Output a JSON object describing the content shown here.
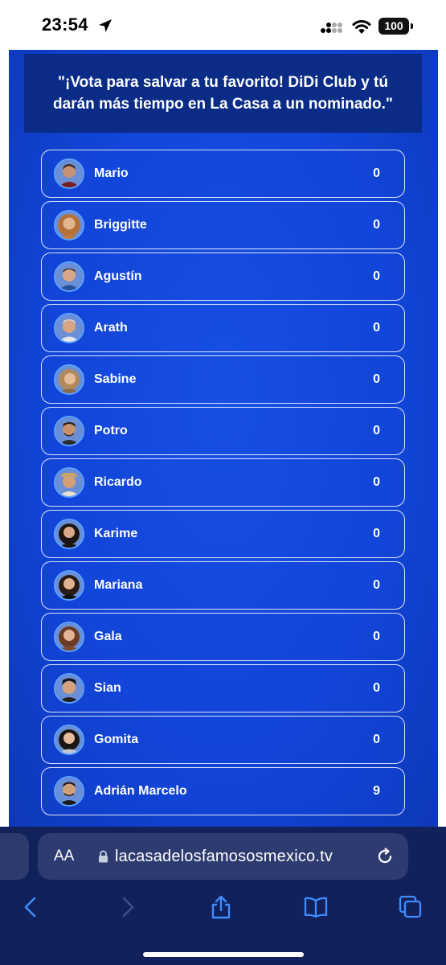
{
  "status_bar": {
    "time": "23:54",
    "battery": "100"
  },
  "banner": {
    "text": "\"¡Vota para salvar a tu favorito! DiDi Club y tú darán más tiempo en La Casa a un nominado.\""
  },
  "contestants": [
    {
      "name": "Mario",
      "votes": "0"
    },
    {
      "name": "Briggitte",
      "votes": "0"
    },
    {
      "name": "Agustín",
      "votes": "0"
    },
    {
      "name": "Arath",
      "votes": "0"
    },
    {
      "name": "Sabine",
      "votes": "0"
    },
    {
      "name": "Potro",
      "votes": "0"
    },
    {
      "name": "Ricardo",
      "votes": "0"
    },
    {
      "name": "Karime",
      "votes": "0"
    },
    {
      "name": "Mariana",
      "votes": "0"
    },
    {
      "name": "Gala",
      "votes": "0"
    },
    {
      "name": "Sian",
      "votes": "0"
    },
    {
      "name": "Gomita",
      "votes": "0"
    },
    {
      "name": "Adrián Marcelo",
      "votes": "9"
    }
  ],
  "browser": {
    "text_size_label": "AA",
    "url": "lacasadelosfamososmexico.tv",
    "icons": [
      "back-icon",
      "forward-icon",
      "share-icon",
      "bookmarks-icon",
      "tabs-icon"
    ]
  },
  "colors": {
    "page_blue": "#1146d8",
    "banner_navy": "#0a2c86",
    "browser_bar": "#13215a",
    "icon_blue": "#3f8cff",
    "icon_disabled": "#3b4f8c"
  }
}
